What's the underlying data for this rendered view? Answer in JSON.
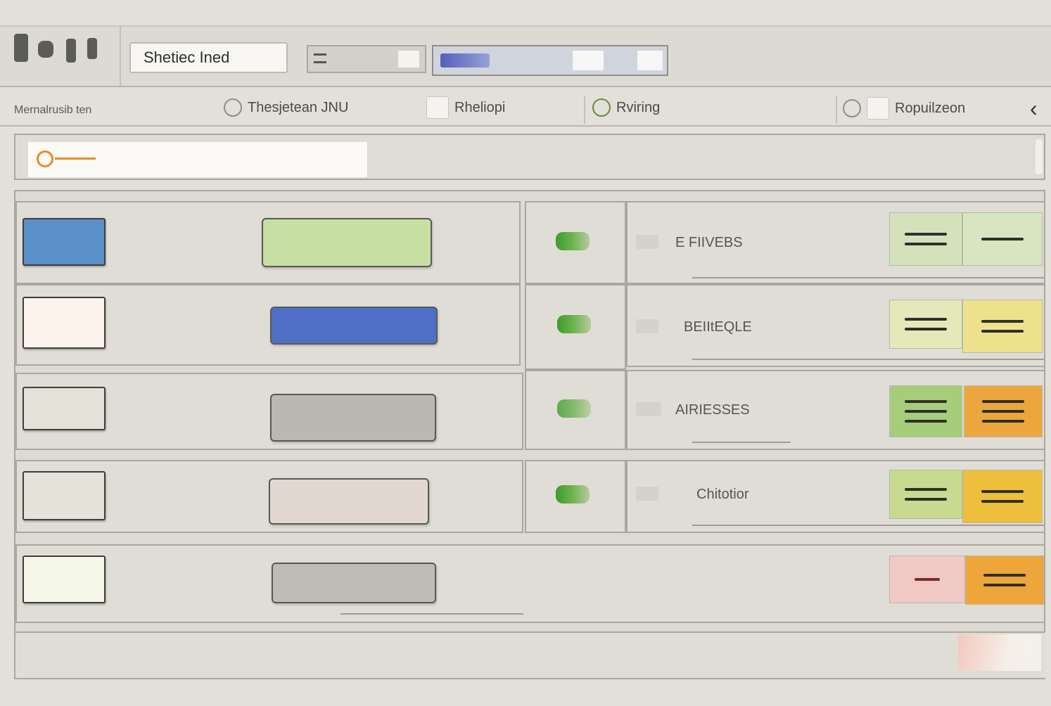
{
  "toolbar": {
    "label_button": "Shetiec Ined",
    "icons": [
      "tool-1-icon",
      "tool-2-icon",
      "tool-3-icon",
      "tool-4-icon"
    ]
  },
  "tabs": {
    "left_label": "Mernalrusib ten",
    "items": [
      {
        "label": "Thesjetean JNU",
        "icon": "circle-icon"
      },
      {
        "label": "Rheliopi",
        "icon": "document-icon"
      },
      {
        "label": "Rviring",
        "icon": "user-icon"
      },
      {
        "label": "Ropuilzeon",
        "icon": "document-icon"
      }
    ],
    "arrow": "‹"
  },
  "search": {
    "placeholder": ""
  },
  "rows": [
    {
      "name": "E FIIVEBS",
      "thumb_color": "#5b8fc7",
      "pill_color": "#c8dfa4",
      "status": "active",
      "act1": "#d4e2bb",
      "act2": "#d7e6c0"
    },
    {
      "name": "BEIItEQLE",
      "thumb_color": "#fbf3ec",
      "pill_color": "#4f6fc7",
      "status": "active",
      "act1": "#e3e9b9",
      "act2": "#ede18c"
    },
    {
      "name": "AIRIESSES",
      "thumb_color": "#e4e2d8",
      "pill_color": "#b9b8b2",
      "status": "active",
      "act1": "#a6cd7a",
      "act2": "#eba73d"
    },
    {
      "name": "Chitotior",
      "thumb_color": "#e4e3da",
      "pill_color": "#e2d8d0",
      "status": "active",
      "act1": "#c6db8f",
      "act2": "#edbf3c"
    },
    {
      "name": "",
      "thumb_color": "#f5f7e8",
      "pill_color": "#bdbcb6",
      "status": "",
      "act1": "#f0c9c4",
      "act2": "#eea53a"
    }
  ],
  "colors": {
    "bg": "#e2e0d8",
    "accent_orange": "#e88a2a",
    "status_green": "#3f9a2e"
  }
}
